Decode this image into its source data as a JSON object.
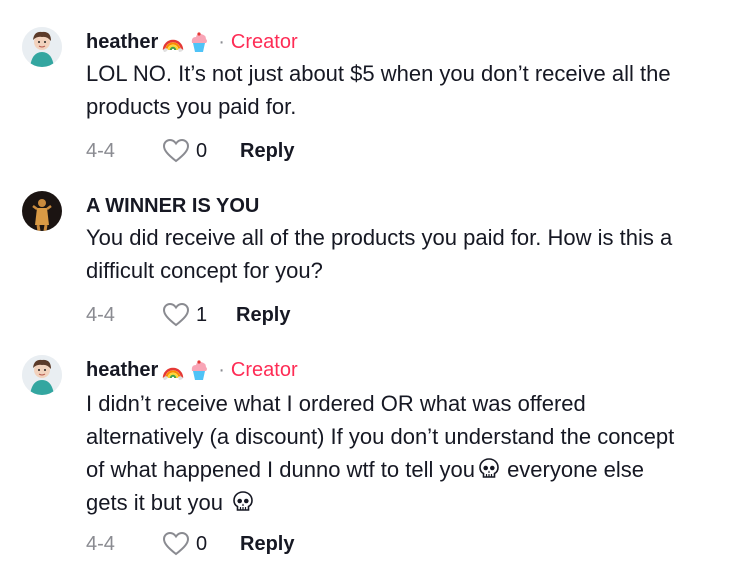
{
  "comments": [
    {
      "username": "heather",
      "badge_separator": "·",
      "badge": "Creator",
      "text": "LOL NO. It’s not just about $5 when you don’t receive all the products you paid for.",
      "date": "4-4",
      "likes": "0",
      "reply_label": "Reply",
      "emojis": [
        "rainbow-emoji",
        "cupcake-emoji"
      ]
    },
    {
      "username": "A WINNER IS YOU",
      "text": "You did receive all of the products you paid for. How is this a difficult concept for you?",
      "date": "4-4",
      "likes": "1",
      "reply_label": "Reply"
    },
    {
      "username": "heather",
      "badge_separator": "·",
      "badge": "Creator",
      "text_line1": "I didn’t receive what I ordered OR what was offered alternatively (a discount) If you don’t understand the concept of what happened I dunno wtf to tell you",
      "text_line2": " everyone else gets it but you ",
      "date": "4-4",
      "likes": "0",
      "reply_label": "Reply",
      "emojis": [
        "rainbow-emoji",
        "cupcake-emoji",
        "skull-emoji"
      ]
    }
  ],
  "colors": {
    "creator": "#fe2c55",
    "muted": "#8a8b91",
    "text": "#161823"
  }
}
